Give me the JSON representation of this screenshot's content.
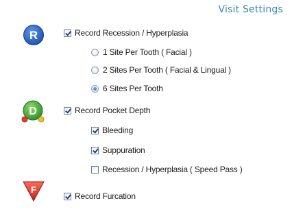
{
  "header": {
    "title": "Visit Settings"
  },
  "sections": {
    "recession": {
      "icon_letter": "R",
      "label": "Record Recession / Hyperplasia",
      "checked": true,
      "options": [
        {
          "label": "1 Site Per Tooth  ( Facial )",
          "selected": false
        },
        {
          "label": "2 Sites Per Tooth  ( Facial & Lingual )",
          "selected": false
        },
        {
          "label": "6 Sites Per Tooth",
          "selected": true
        }
      ]
    },
    "pocket_depth": {
      "icon_letter": "D",
      "label": "Record Pocket Depth",
      "checked": true,
      "sub_options": [
        {
          "label": "Bleeding",
          "checked": true
        },
        {
          "label": "Suppuration",
          "checked": true
        },
        {
          "label": "Recession / Hyperplasia ( Speed Pass )",
          "checked": false
        }
      ]
    },
    "furcation": {
      "icon_letter": "F",
      "label": "Record Furcation",
      "checked": true
    }
  },
  "colors": {
    "title": "#3a86b0",
    "recession_icon": "#2a63c4",
    "pocket_icon": "#3fa23a",
    "furcation_icon": "#d83a32"
  }
}
